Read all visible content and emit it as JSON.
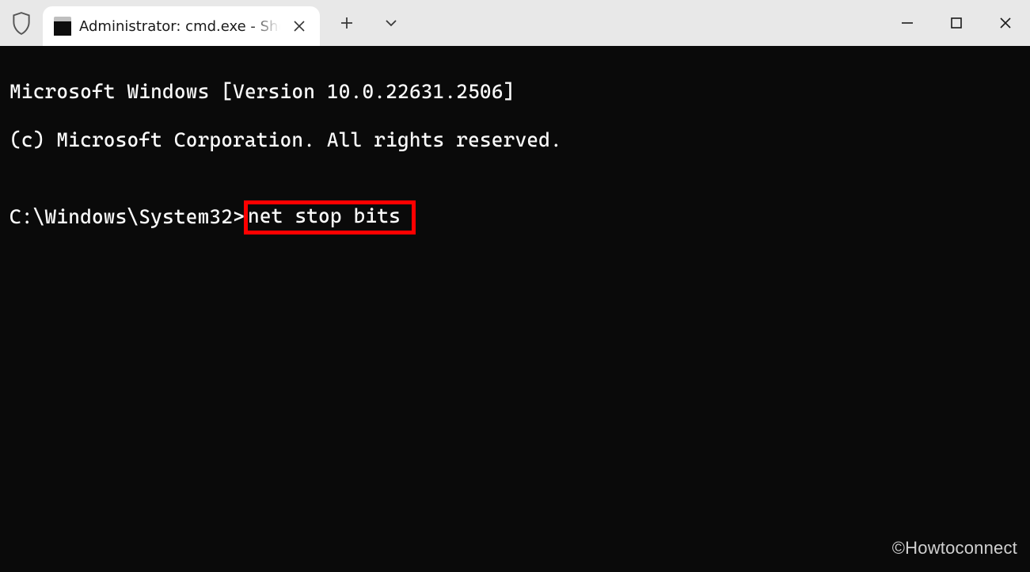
{
  "tab": {
    "title": "Administrator: cmd.exe - Shor"
  },
  "terminal": {
    "line1": "Microsoft Windows [Version 10.0.22631.2506]",
    "line2": "(c) Microsoft Corporation. All rights reserved.",
    "blank": "",
    "prompt": "C:\\Windows\\System32>",
    "command": "net stop bits"
  },
  "watermark": "©Howtoconnect"
}
